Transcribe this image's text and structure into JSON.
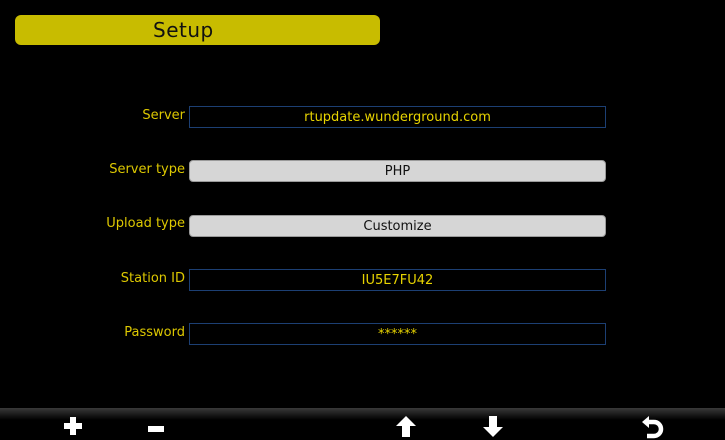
{
  "header": {
    "title": "Setup"
  },
  "form": {
    "server": {
      "label": "Server",
      "value": "rtupdate.wunderground.com"
    },
    "server_type": {
      "label": "Server type",
      "value": "PHP"
    },
    "upload_type": {
      "label": "Upload type",
      "value": "Customize"
    },
    "station_id": {
      "label": "Station ID",
      "value": "IU5E7FU42"
    },
    "password": {
      "label": "Password",
      "value": "******"
    }
  },
  "toolbar": {
    "icons": [
      "plus-icon",
      "minus-icon",
      "arrow-up-icon",
      "arrow-down-icon",
      "return-icon"
    ]
  },
  "colors": {
    "background": "#000000",
    "title_bar": "#c8bc00",
    "label_text": "#ddc800",
    "field_text": "#e8d400",
    "field_border": "#1c3f73",
    "select_fill": "#d6d6d6"
  }
}
